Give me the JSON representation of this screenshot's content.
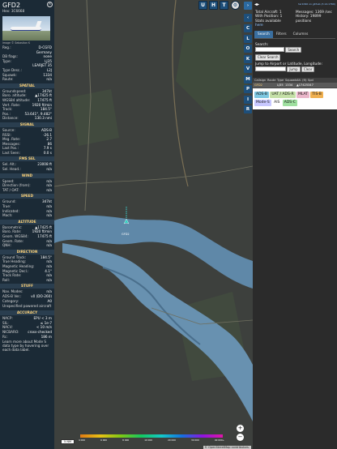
{
  "left": {
    "callsign": "GFD2",
    "hex_line": "Hex: 3C6668",
    "photo_credit": "Image © Sebastian K",
    "general": [
      {
        "k": "Reg.:",
        "v": "D-CGFD"
      },
      {
        "k": "",
        "v": "Germany"
      },
      {
        "k": "DB flags:",
        "v": "none"
      },
      {
        "k": "Type:",
        "v": "LJ35"
      },
      {
        "k": "",
        "v": "LEARJET 35"
      },
      {
        "k": "Type Desc.:",
        "v": "L2J"
      },
      {
        "k": "Squawk:",
        "v": "1334"
      },
      {
        "k": "Route:",
        "v": "n/a"
      }
    ],
    "spatial_title": "SPATIAL",
    "spatial": [
      {
        "k": "Groundspeed:",
        "v": "347kt"
      },
      {
        "k": "Baro. altitude:",
        "v": "▲17425 ft"
      },
      {
        "k": "WGS84 altitude:",
        "v": "17475 ft"
      },
      {
        "k": "Vert. Rate:",
        "v": "1920 ft/min"
      },
      {
        "k": "Track:",
        "v": "184.5°"
      },
      {
        "k": "Pos.:",
        "v": "53.641°, 9.482°"
      },
      {
        "k": "Distance:",
        "v": "130.3 nmi"
      }
    ],
    "signal_title": "SIGNAL",
    "signal": [
      {
        "k": "Source:",
        "v": "ADS-B"
      },
      {
        "k": "RSSI:",
        "v": "-26.1"
      },
      {
        "k": "Msg. Rate:",
        "v": "2.7"
      },
      {
        "k": "Messages:",
        "v": "86"
      },
      {
        "k": "Last Pos.:",
        "v": "7.9 s"
      },
      {
        "k": "Last Seen:",
        "v": "0.0 s"
      }
    ],
    "fms_title": "FMS SEL",
    "fms": [
      {
        "k": "Sel. Alt.:",
        "v": "23008 ft"
      },
      {
        "k": "Sel. Head.:",
        "v": "n/a"
      }
    ],
    "wind_title": "WIND",
    "wind": [
      {
        "k": "Speed:",
        "v": "n/a"
      },
      {
        "k": "Direction (from):",
        "v": "n/a"
      },
      {
        "k": "TAT / OAT:",
        "v": "n/a"
      }
    ],
    "speed_title": "SPEED",
    "speed": [
      {
        "k": "Ground:",
        "v": "347kt"
      },
      {
        "k": "True:",
        "v": "n/a"
      },
      {
        "k": "Indicated:",
        "v": "n/a"
      },
      {
        "k": "Mach:",
        "v": "n/a"
      }
    ],
    "altitude_title": "ALTITUDE",
    "altitude": [
      {
        "k": "Barometric:",
        "v": "▲17425 ft"
      },
      {
        "k": "Baro. Rate:",
        "v": "1920 ft/min"
      },
      {
        "k": "Geom. WGS84:",
        "v": "17475 ft"
      },
      {
        "k": "Geom. Rate:",
        "v": "n/a"
      },
      {
        "k": "QNH:",
        "v": "n/a"
      }
    ],
    "direction_title": "DIRECTION",
    "direction": [
      {
        "k": "Ground Track:",
        "v": "184.5°"
      },
      {
        "k": "True Heading:",
        "v": "n/a"
      },
      {
        "k": "Magnetic Heading:",
        "v": "n/a"
      },
      {
        "k": "Magnetic Decl.:",
        "v": "4.1°"
      },
      {
        "k": "Track Rate:",
        "v": "n/a"
      },
      {
        "k": "Roll:",
        "v": "n/a"
      }
    ],
    "stuff_title": "STUFF",
    "stuff": [
      {
        "k": "Nav. Modes:",
        "v": "n/a"
      },
      {
        "k": "ADS-B Ver.:",
        "v": "v0 (DO-260)"
      },
      {
        "k": "Category:",
        "v": "A0"
      }
    ],
    "stuff_note": "Unspecified powered aircraft",
    "accuracy_title": "ACCURACY",
    "accuracy": [
      {
        "k": "NACP:",
        "v": "EPU < 3 m"
      },
      {
        "k": "SIL:",
        "v": "≤ 1e-7"
      },
      {
        "k": "NACV:",
        "v": "< 10 m/s"
      },
      {
        "k": "NICBARO:",
        "v": "cross-checked"
      },
      {
        "k": "Rc:",
        "v": "186 m"
      }
    ],
    "footer_note": "Learn more about Mode S data type by hovering over each data label."
  },
  "map": {
    "top_buttons": [
      "U",
      "H",
      "T"
    ],
    "side_buttons": [
      "C",
      "L",
      "O",
      "K",
      "V",
      "M",
      "P",
      "I",
      "R"
    ],
    "scale_label": "5 NM",
    "alt_labels": [
      "4 000",
      "6 000",
      "8 000",
      "10 000",
      "20 000",
      "30 000",
      "40 000+"
    ],
    "attribution": "© OpenStreetMap contributors.",
    "zoom_in": "+",
    "zoom_out": "−",
    "plane_label": "GFD2"
  },
  "right": {
    "version": "tar1090 on github (3.14.1760)",
    "total_aircraft": "Total Aircraft: 1",
    "with_position": "With Position: 1",
    "messages": "Messages: 1369 /sec",
    "history": "History: 19899 positions",
    "stats_available": "Stats available",
    "stats_link": "here",
    "tabs": [
      "Search",
      "Filters",
      "Columns"
    ],
    "search_label": "Search:",
    "search_button": "Search",
    "clear_search": "Clear Search",
    "jump_label": "Jump to Airport or Latitude, Longitude:",
    "jump_button": "Jump",
    "clear_button": "Clear",
    "columns": [
      "Callsign",
      "Route",
      "Type",
      "Squawk",
      "Alt. (ft)",
      "Spd"
    ],
    "rows": [
      {
        "callsign": "GFD2",
        "route": "",
        "type": "LJ35",
        "squawk": "1334",
        "alt": "▲17425",
        "spd": "347"
      }
    ],
    "badges": [
      {
        "label": "ADS-B",
        "color": "#7ec7e0"
      },
      {
        "label": "UAT / ADS-R",
        "color": "#c5e0a8"
      },
      {
        "label": "MLAT",
        "color": "#e9b6c9"
      },
      {
        "label": "TIS-B",
        "color": "#f0b050"
      },
      {
        "label": "Mode-S",
        "color": "#c8c8ff"
      },
      {
        "label": "AIS",
        "color": "#ffffff"
      },
      {
        "label": "ADS-C",
        "color": "#9fe0a0"
      }
    ]
  }
}
